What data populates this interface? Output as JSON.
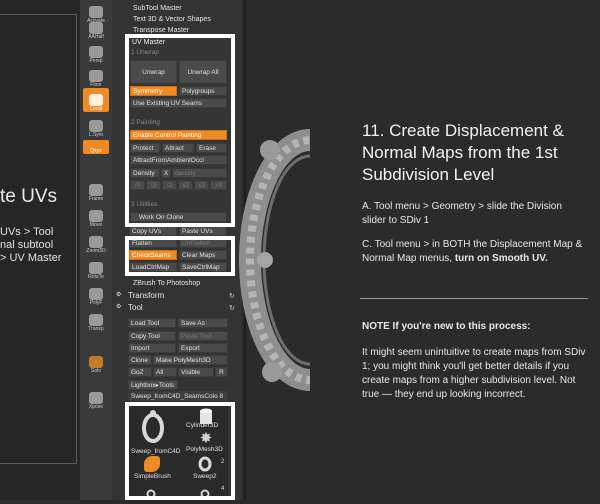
{
  "left_slide": {
    "title": "te UVs",
    "lines": [
      "UVs > Tool",
      "nal subtool",
      "> UV Master"
    ]
  },
  "icon_column": [
    {
      "name": "activate",
      "label": "Activate"
    },
    {
      "name": "aahalf",
      "label": "AAHalf"
    },
    {
      "name": "dynamic-persp",
      "label": "Persp"
    },
    {
      "name": "floor",
      "label": "Floor"
    },
    {
      "name": "local",
      "label": "Local",
      "active": true
    },
    {
      "name": "l-sym",
      "label": "L.Sym"
    },
    {
      "name": "qxyz",
      "label": "Qxyz",
      "active": true
    },
    {
      "name": "frame",
      "label": "Frame"
    },
    {
      "name": "move",
      "label": "Move"
    },
    {
      "name": "zoom3d",
      "label": "Zoom3D"
    },
    {
      "name": "rotate",
      "label": "RotaTe"
    },
    {
      "name": "linefill-polyf",
      "label": "PolyF"
    },
    {
      "name": "transp",
      "label": "Transp"
    },
    {
      "name": "dynamic-solo",
      "label": "Solo"
    },
    {
      "name": "xpose",
      "label": "Xpose"
    }
  ],
  "palette": {
    "top_items": [
      "SubTool Master",
      "Text 3D & Vector Shapes",
      "Transpose Master"
    ],
    "uv_master": {
      "title": "UV Master",
      "sec1": "1 Unwrap",
      "unwrap": "Unwrap",
      "unwrap_all": "Unwrap All",
      "symmetry": "Symmetry",
      "polygroups": "Polygroups",
      "use_existing": "Use Existing UV Seams",
      "sec2": "2 Painting",
      "enable_cp": "Enable Control Painting",
      "protect": "Protect",
      "attract": "Attract",
      "erase": "Erase",
      "attract_ambient": "AttractFromAmbientOccl",
      "density": "Density",
      "density_x": "X",
      "density_field": "density",
      "density_steps": [
        "/4",
        "/3",
        "/2",
        "x2",
        "x3",
        "x4"
      ],
      "sec3": "3 Utilities",
      "work_on_clone": "Work On Clone"
    },
    "copy_uvs": "Copy UVs",
    "paste_uvs": "Paste UVs",
    "flatten": "Flatten",
    "unflatten": "UnFlatten",
    "checkseams": "CheckSeams",
    "clear_maps": "Clear Maps",
    "load_ctrlmap": "LoadCtrlMap",
    "save_ctrlmap": "SaveCtrlMap",
    "zbrush_to_photoshop": "ZBrush To Photoshop",
    "transform": "Transform",
    "tool": "Tool",
    "tool_buttons": {
      "load_tool": "Load Tool",
      "save_as": "Save As",
      "copy_tool": "Copy Tool",
      "paste_tool": "Paste Tool",
      "import": "Import",
      "export": "Export",
      "clone": "Clone",
      "make_polymesh": "Make PolyMesh3D",
      "goz": "GoZ",
      "all": "All",
      "visible": "Visible",
      "r": "R",
      "lightbox": "Lightbox▸Tools",
      "current_tool": "Sweep_fromC4D_SeamsColo 8"
    },
    "thumbnails": [
      {
        "label": "Sweep_fromC4D",
        "kind": "frame"
      },
      {
        "label": "Cylinder3D",
        "kind": "cylinder"
      },
      {
        "label": "",
        "kind": "star"
      },
      {
        "label": "PolyMesh3D",
        "kind": "star"
      },
      {
        "label": "SimpleBrush",
        "kind": "simple"
      },
      {
        "label": "Sweep2",
        "kind": "frame"
      }
    ],
    "thumb_badges": [
      "2",
      "4"
    ]
  },
  "slide": {
    "title": "11. Create Displacement & Normal Maps from the 1st Subdivision Level",
    "p1": "A. Tool menu > Geometry > slide the Division slider to SDiv 1",
    "p2_pre": "C. Tool menu > in BOTH the Displacement Map & Normal Map menus, ",
    "p2_bold": "turn on Smooth UV.",
    "note": "NOTE If you're new to this process:",
    "p3": "It might seem unintuitive to create maps from SDiv 1; you might think you'll get better details if you create maps from a higher subdivision level. Not true — they end up looking incorrect."
  },
  "colors": {
    "accent": "#f08a24",
    "panel": "#333333",
    "button": "#4a4a4a",
    "slide_bg": "#2b2b2b",
    "highlight_box": "#ffffff"
  }
}
